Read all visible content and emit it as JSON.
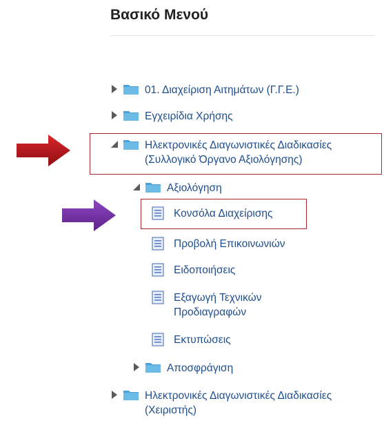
{
  "menu": {
    "title": "Βασικό Μενού",
    "items": [
      {
        "label": "01. Διαχείριση Αιτημάτων (Γ.Γ.Ε.)"
      },
      {
        "label": "Εγχειρίδια Χρήσης"
      },
      {
        "label_line1": "Ηλεκτρονικές Διαγωνιστικές Διαδικασίες",
        "label_line2": "(Συλλογικό Όργανο Αξιολόγησης)"
      },
      {
        "label": "Αξιολόγηση"
      },
      {
        "label": "Κονσόλα Διαχείρισης"
      },
      {
        "label": "Προβολή Επικοινωνιών"
      },
      {
        "label": "Ειδοποιήσεις"
      },
      {
        "label_line1": "Εξαγωγή Τεχνικών",
        "label_line2": "Προδιαγραφών"
      },
      {
        "label": "Εκτυπώσεις"
      },
      {
        "label": "Αποσφράγιση"
      },
      {
        "label_line1": "Ηλεκτρονικές Διαγωνιστικές Διαδικασίες",
        "label_line2": "(Χειριστής)"
      }
    ]
  },
  "colors": {
    "link": "#1f4e8c",
    "folder": "#4aa3d8",
    "highlight_box": "#a8262a",
    "arrow_red": "#c0151b",
    "arrow_purple": "#7a35a8"
  }
}
